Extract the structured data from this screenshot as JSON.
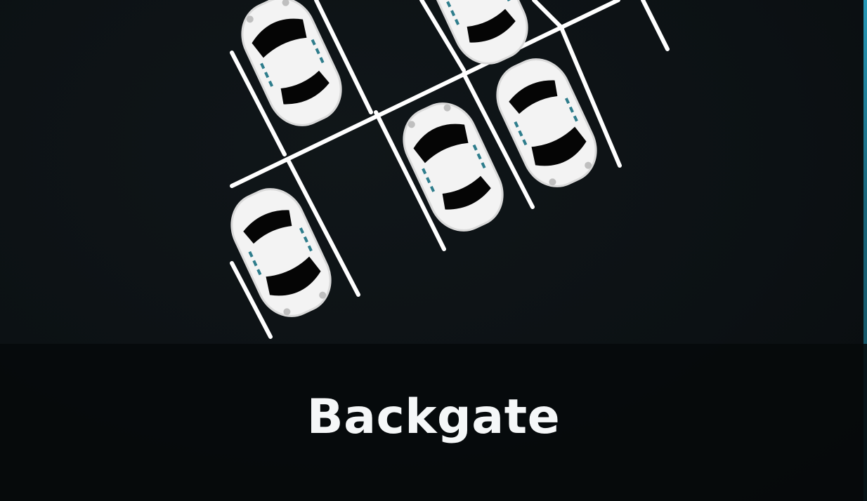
{
  "tile": {
    "label": "Backgate",
    "illustration_icon": "parking-lot-icon",
    "accent_color": "#2aa7c9"
  }
}
